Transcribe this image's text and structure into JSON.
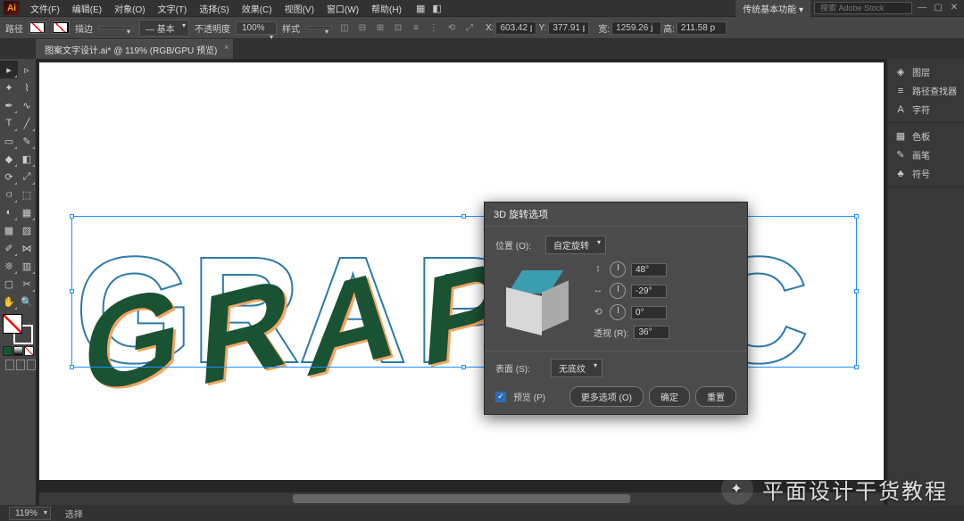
{
  "menu": [
    "文件(F)",
    "编辑(E)",
    "对象(O)",
    "文字(T)",
    "选择(S)",
    "效果(C)",
    "视图(V)",
    "窗口(W)",
    "帮助(H)"
  ],
  "workspace_label": "传统基本功能",
  "search_placeholder": "搜索 Adobe Stock",
  "control": {
    "path_label": "路径",
    "stroke_label": "描边",
    "stroke_dd": "",
    "style_label": "基本",
    "opacity_label": "不透明度",
    "opacity_val": "100%",
    "profile_label": "样式",
    "x_label": "X:",
    "x_val": "603.42 p",
    "y_label": "Y:",
    "y_val": "377.91 p",
    "w_label": "宽:",
    "w_val": "1259.26 j",
    "h_label": "高:",
    "h_val": "211.58 p"
  },
  "doc_tab": "图案文字设计.ai* @ 119% (RGB/GPU 预览)",
  "artwork_text": "GRAPHIC",
  "right_panels": {
    "group1": [
      {
        "icon": "◈",
        "label": "图层"
      },
      {
        "icon": "≡",
        "label": "路径查找器"
      },
      {
        "icon": "A",
        "label": "字符"
      }
    ],
    "group2": [
      {
        "icon": "▦",
        "label": "色板"
      },
      {
        "icon": "✎",
        "label": "画笔"
      },
      {
        "icon": "♣",
        "label": "符号"
      }
    ]
  },
  "dialog": {
    "title": "3D 旋转选项",
    "position_label": "位置 (O):",
    "position_value": "自定旋转",
    "rot_x": "48°",
    "rot_y": "-29°",
    "rot_z": "0°",
    "perspective_label": "透视 (R):",
    "perspective_value": "36°",
    "surface_label": "表面 (S):",
    "surface_value": "无底纹",
    "preview_label": "预览 (P)",
    "more_options": "更多选项 (O)",
    "ok": "确定",
    "reset": "重置"
  },
  "status": {
    "zoom": "119%",
    "selection": "选择"
  },
  "watermark": "平面设计干货教程"
}
